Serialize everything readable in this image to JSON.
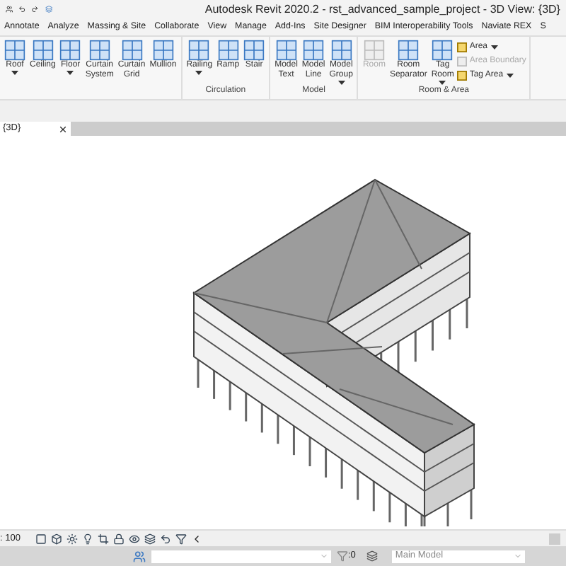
{
  "window": {
    "title": "Autodesk Revit 2020.2 - rst_advanced_sample_project - 3D View: {3D}"
  },
  "tabs": [
    {
      "label": "Annotate"
    },
    {
      "label": "Analyze"
    },
    {
      "label": "Massing & Site"
    },
    {
      "label": "Collaborate"
    },
    {
      "label": "View"
    },
    {
      "label": "Manage"
    },
    {
      "label": "Add-Ins"
    },
    {
      "label": "Site Designer"
    },
    {
      "label": "BIM Interoperability Tools"
    },
    {
      "label": "Naviate REX"
    },
    {
      "label": "S"
    }
  ],
  "panels": [
    {
      "buttons": [
        {
          "lines": [
            "Roof"
          ],
          "dropdown": true,
          "disabled": false
        },
        {
          "lines": [
            "Ceiling"
          ],
          "dropdown": false,
          "disabled": false
        },
        {
          "lines": [
            "Floor"
          ],
          "dropdown": true,
          "disabled": false
        },
        {
          "lines": [
            "Curtain",
            "System"
          ],
          "dropdown": false,
          "disabled": false
        },
        {
          "lines": [
            "Curtain",
            "Grid"
          ],
          "dropdown": false,
          "disabled": false
        },
        {
          "lines": [
            "Mullion"
          ],
          "dropdown": false,
          "disabled": false
        }
      ]
    },
    {
      "label": "Circulation",
      "buttons": [
        {
          "lines": [
            "Railing"
          ],
          "dropdown": true,
          "disabled": false
        },
        {
          "lines": [
            "Ramp"
          ],
          "dropdown": false,
          "disabled": false
        },
        {
          "lines": [
            "Stair"
          ],
          "dropdown": false,
          "disabled": false
        }
      ]
    },
    {
      "label": "Model",
      "buttons": [
        {
          "lines": [
            "Model",
            "Text"
          ],
          "dropdown": false,
          "disabled": false
        },
        {
          "lines": [
            "Model",
            "Line"
          ],
          "dropdown": false,
          "disabled": false
        },
        {
          "lines": [
            "Model",
            "Group"
          ],
          "dropdown": true,
          "disabled": false
        }
      ]
    },
    {
      "label": "Room & Area",
      "buttons": [
        {
          "lines": [
            "Room"
          ],
          "dropdown": false,
          "disabled": true
        },
        {
          "lines": [
            "Room",
            "Separator"
          ],
          "dropdown": false,
          "disabled": false
        },
        {
          "lines": [
            "Tag",
            "Room"
          ],
          "dropdown": true,
          "disabled": false
        }
      ],
      "small_buttons": [
        {
          "label": "Area",
          "dropdown": true,
          "disabled": false
        },
        {
          "label": "Area Boundary",
          "dropdown": false,
          "disabled": true
        },
        {
          "label": "Tag Area",
          "dropdown": true,
          "disabled": false
        }
      ]
    }
  ],
  "view_tab": {
    "label": "{3D}"
  },
  "view_control": {
    "scale": ": 100"
  },
  "status_bar": {
    "count": ":0",
    "model": "Main Model"
  }
}
